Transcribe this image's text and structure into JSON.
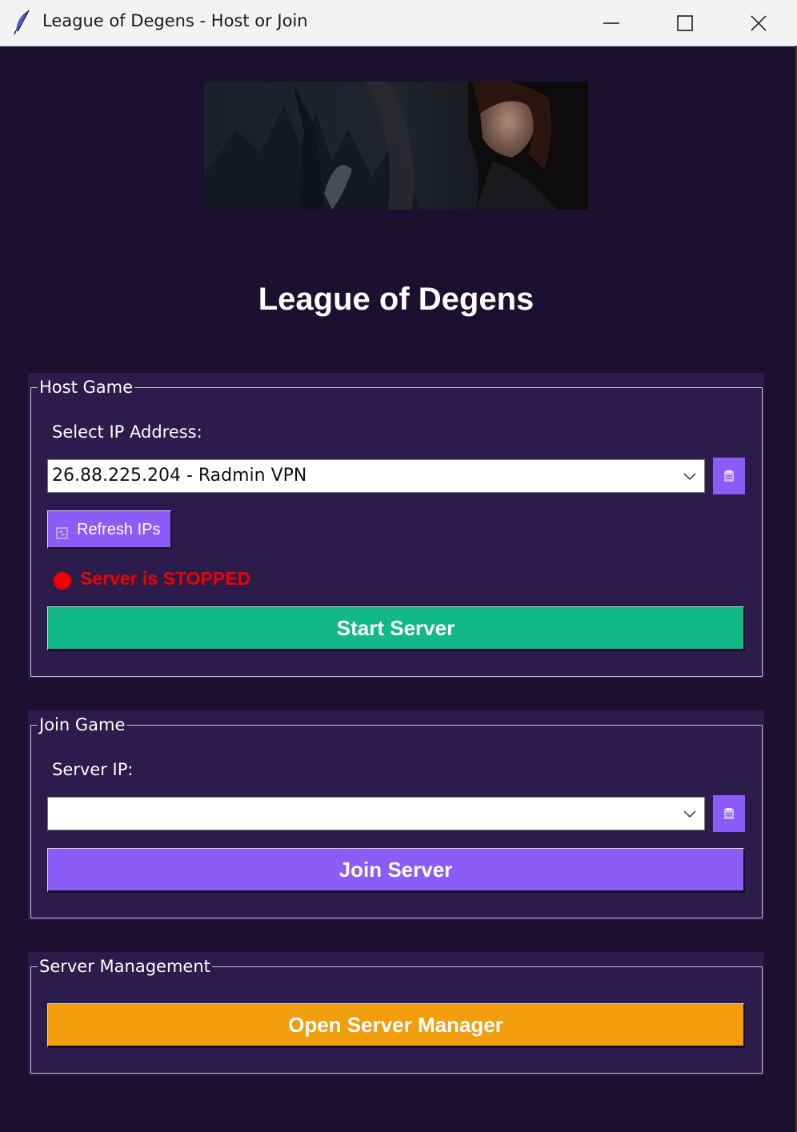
{
  "window": {
    "title": "League of Degens - Host or Join"
  },
  "app": {
    "title": "League of Degens"
  },
  "host_game": {
    "legend": "Host Game",
    "ip_label": "Select IP Address:",
    "ip_value": "26.88.225.204 - Radmin VPN",
    "refresh_label": "Refresh IPs",
    "status_text": "Server is STOPPED",
    "status_color": "#ee0000",
    "start_label": "Start Server"
  },
  "join_game": {
    "legend": "Join Game",
    "ip_label": "Server IP:",
    "ip_value": "",
    "join_label": "Join Server"
  },
  "server_management": {
    "legend": "Server Management",
    "open_label": "Open Server Manager"
  },
  "colors": {
    "background": "#1c1030",
    "panel": "#2b1c4b",
    "accent_purple": "#8b5cf6",
    "start_green": "#12b886",
    "manager_orange": "#f29d0b"
  },
  "icons": {
    "app": "feather-icon",
    "copy": "clipboard-icon",
    "refresh": "refresh-icon"
  }
}
